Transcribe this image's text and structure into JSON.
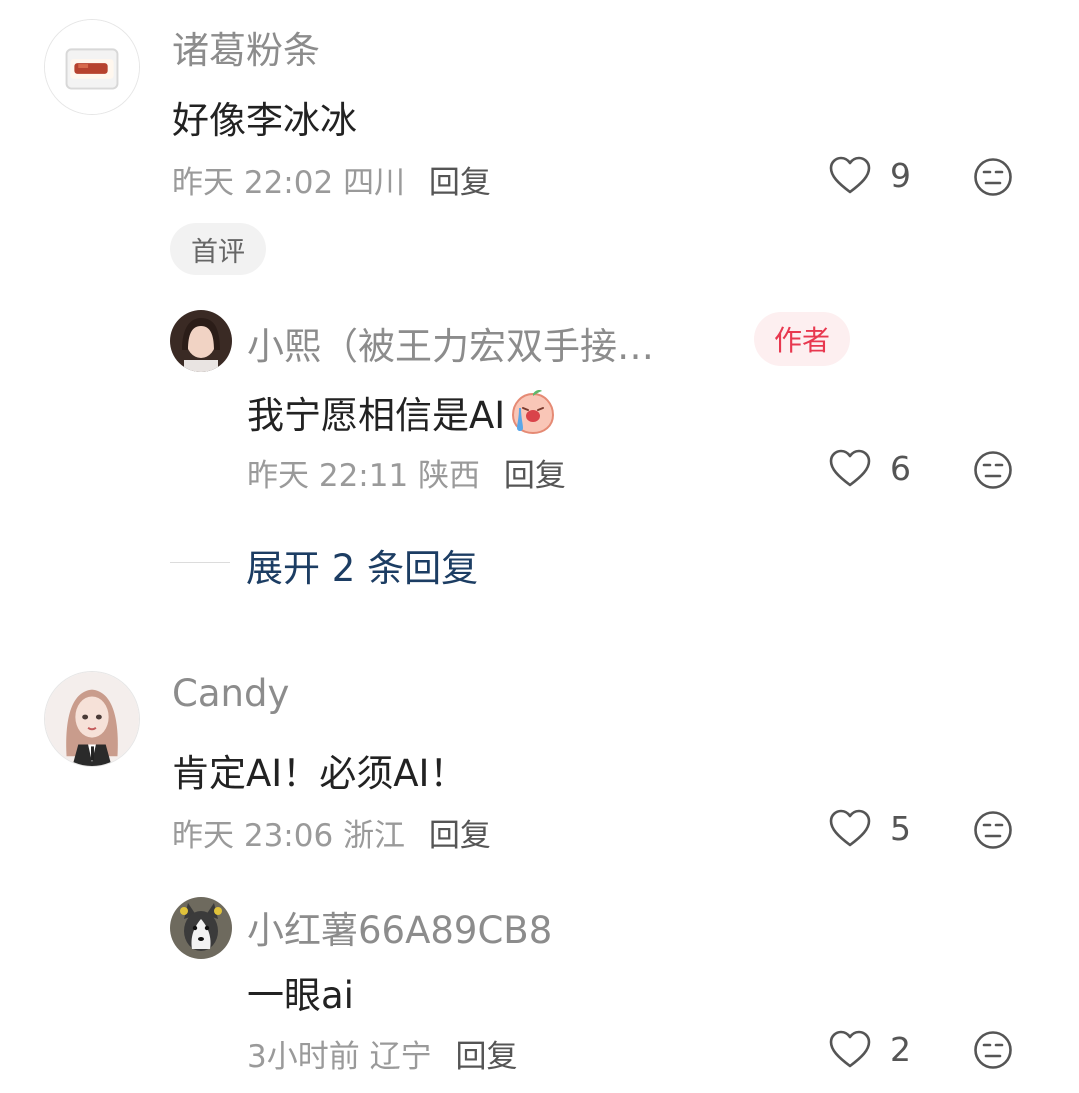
{
  "comments": [
    {
      "username": "诸葛粉条",
      "content": "好像李冰冰",
      "time": "昨天 22:02",
      "location": "四川",
      "reply_label": "回复",
      "likes": "9",
      "badge": "首评",
      "avatar": "food-box-avatar",
      "replies": [
        {
          "username": "小熙（被王力宏双手接…",
          "author_badge": "作者",
          "content": "我宁愿相信是AI",
          "emoji": "crying-peach-emoji",
          "time": "昨天 22:11",
          "location": "陕西",
          "reply_label": "回复",
          "likes": "6",
          "avatar": "woman-photo-avatar"
        }
      ],
      "expand_label": "展开 2 条回复"
    },
    {
      "username": "Candy",
      "content": "肯定AI！必须AI！",
      "time": "昨天 23:06",
      "location": "浙江",
      "reply_label": "回复",
      "likes": "5",
      "avatar": "anime-girl-avatar",
      "replies": [
        {
          "username": "小红薯66A89CB8",
          "content": "一眼ai",
          "time": "3小时前",
          "location": "辽宁",
          "reply_label": "回复",
          "likes": "2",
          "avatar": "husky-dog-avatar"
        }
      ]
    }
  ],
  "colors": {
    "name": "#8c8c8c",
    "meta": "#9a9a9a",
    "expand": "#1c3d63",
    "author_badge_text": "#e8384f",
    "author_badge_bg": "#fdeff0"
  }
}
